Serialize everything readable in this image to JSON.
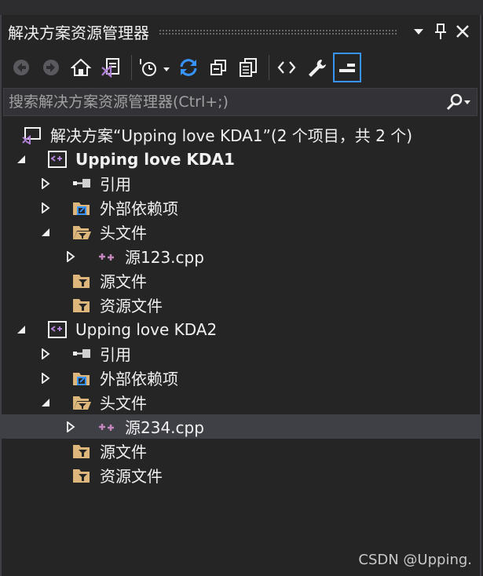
{
  "panel": {
    "title": "解决方案资源管理器",
    "search_placeholder": "搜索解决方案资源管理器(Ctrl+;)"
  },
  "tree": {
    "solution": "解决方案“Upping love KDA1”(2 个项目，共 2 个)",
    "projects": [
      {
        "name": "Upping love KDA1",
        "references": "引用",
        "external_deps": "外部依赖项",
        "header_files": "头文件",
        "header_child": "源123.cpp",
        "source_files": "源文件",
        "resource_files": "资源文件"
      },
      {
        "name": "Upping love KDA2",
        "references": "引用",
        "external_deps": "外部依赖项",
        "header_files": "头文件",
        "header_child": "源234.cpp",
        "source_files": "源文件",
        "resource_files": "资源文件"
      }
    ]
  },
  "selected_item": "源234.cpp",
  "watermark": "CSDN @Upping.",
  "colors": {
    "background": "#252526",
    "selection": "#3f3f46",
    "accent_blue": "#3794ff",
    "folder": "#dcb67a",
    "vs_purple": "#9b59d0"
  }
}
